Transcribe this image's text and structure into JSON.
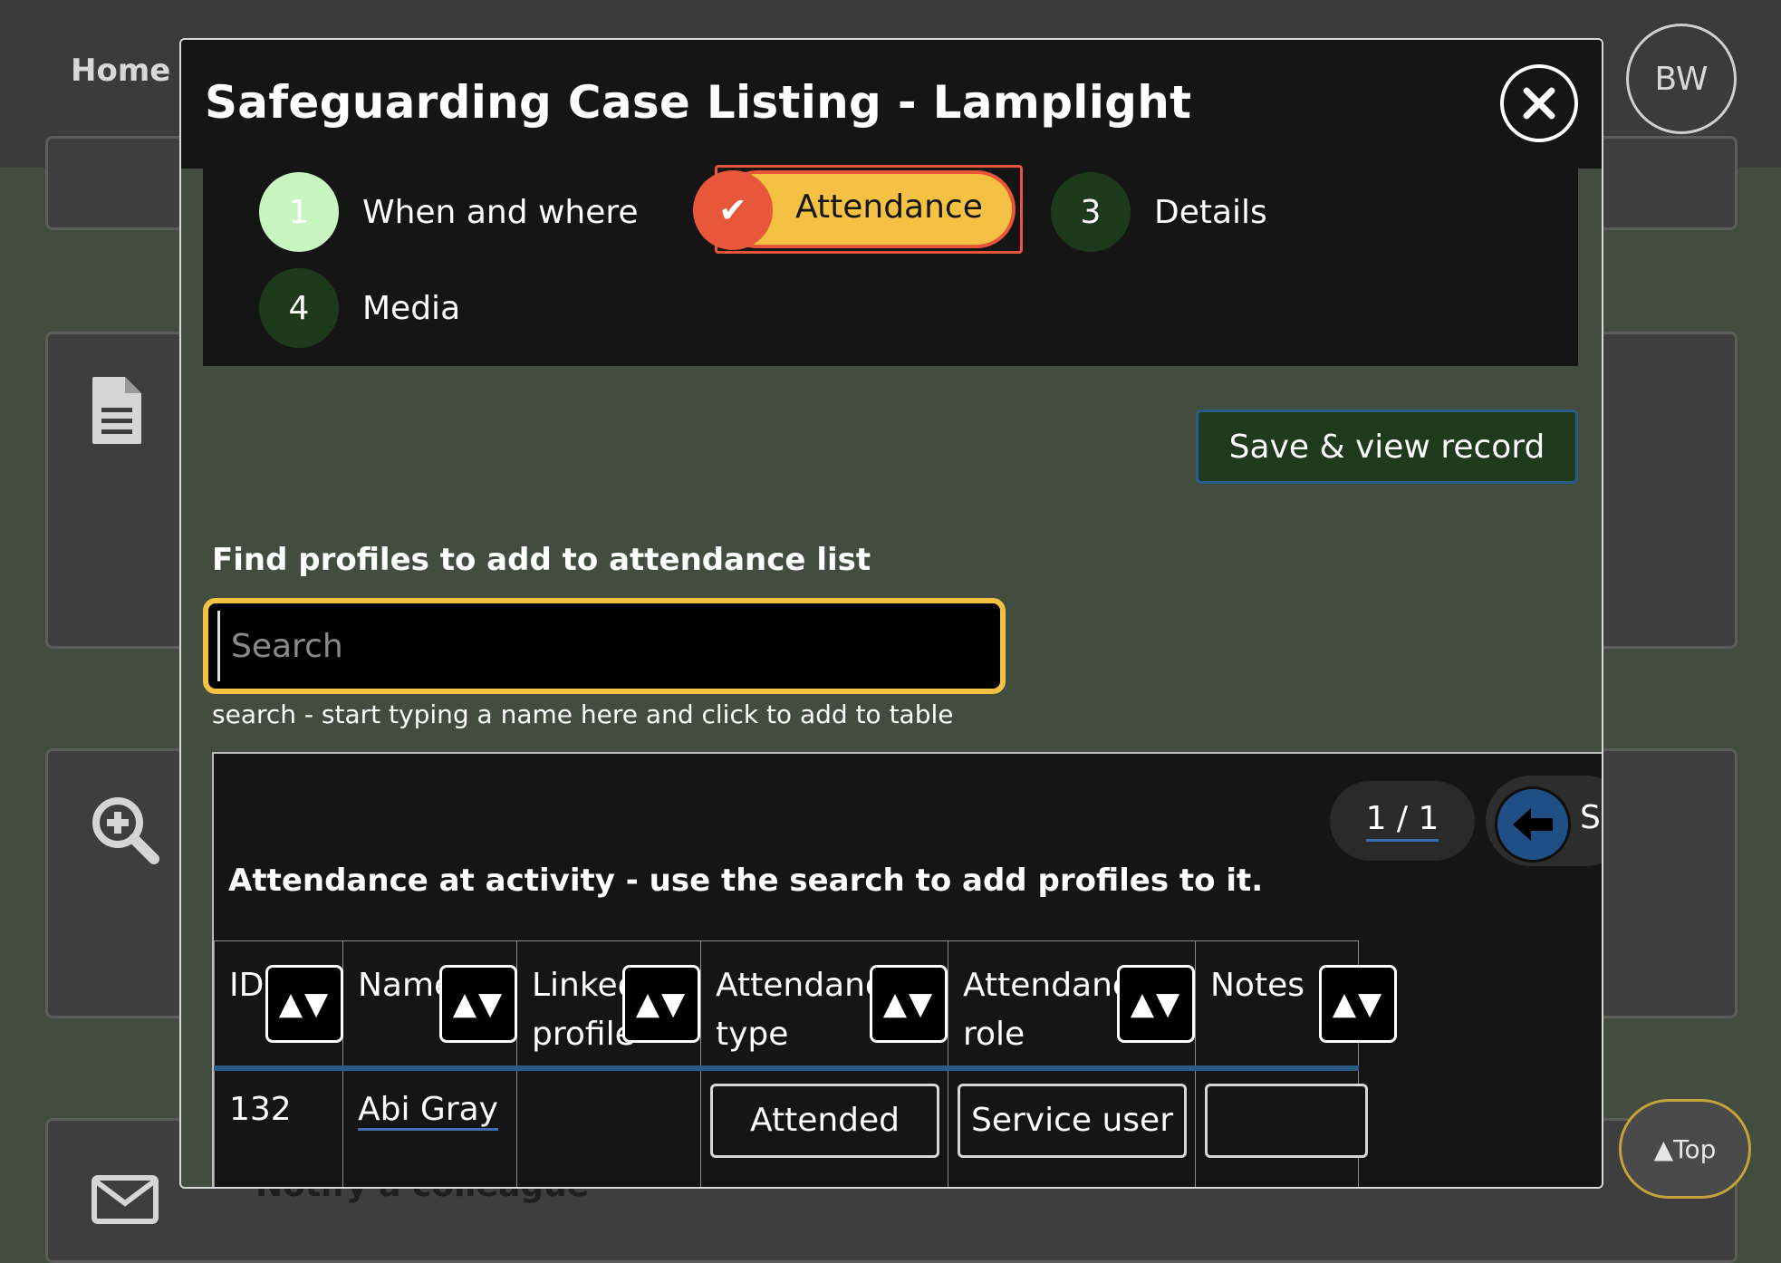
{
  "background": {
    "nav_home": "Home",
    "avatar_initials": "BW",
    "partial_caption": "Notify a colleague",
    "top_button": "▲Top"
  },
  "modal": {
    "title": "Safeguarding Case Listing - Lamplight",
    "steps": [
      {
        "number": "1",
        "label": "When and where",
        "state": "complete"
      },
      {
        "number": "✔",
        "label": "Attendance",
        "state": "current"
      },
      {
        "number": "3",
        "label": "Details",
        "state": "pending"
      },
      {
        "number": "4",
        "label": "Media",
        "state": "pending"
      }
    ],
    "save_button": "Save & view record",
    "find_label": "Find profiles to add to attendance list",
    "search": {
      "placeholder": "Search",
      "value": "",
      "hint": "search - start typing a name here and click to add to table"
    },
    "table": {
      "pager": "1 / 1",
      "next_label_partial": "S",
      "caption": "Attendance at activity - use the search to add profiles to it.",
      "columns": [
        {
          "label": "ID",
          "sort": "▲▼"
        },
        {
          "label": "Name",
          "sort": "▲▼"
        },
        {
          "label": "Linked profile",
          "sort": "▲▼"
        },
        {
          "label": "Attendance type",
          "sort": "▲▼"
        },
        {
          "label": "Attendance role",
          "sort": "▲▼"
        },
        {
          "label": "Notes",
          "sort": "▲▼"
        }
      ],
      "rows": [
        {
          "id": "132",
          "name": "Abi Gray",
          "linked_profile": "",
          "attendance_type": "Attended",
          "attendance_role": "Service user",
          "notes": ""
        }
      ]
    }
  },
  "colors": {
    "accent_yellow": "#f4c143",
    "accent_orange": "#e7573a",
    "step_complete": "#c8f5c0",
    "step_pending": "#1e3a1c",
    "link_blue": "#3c6fb0"
  }
}
